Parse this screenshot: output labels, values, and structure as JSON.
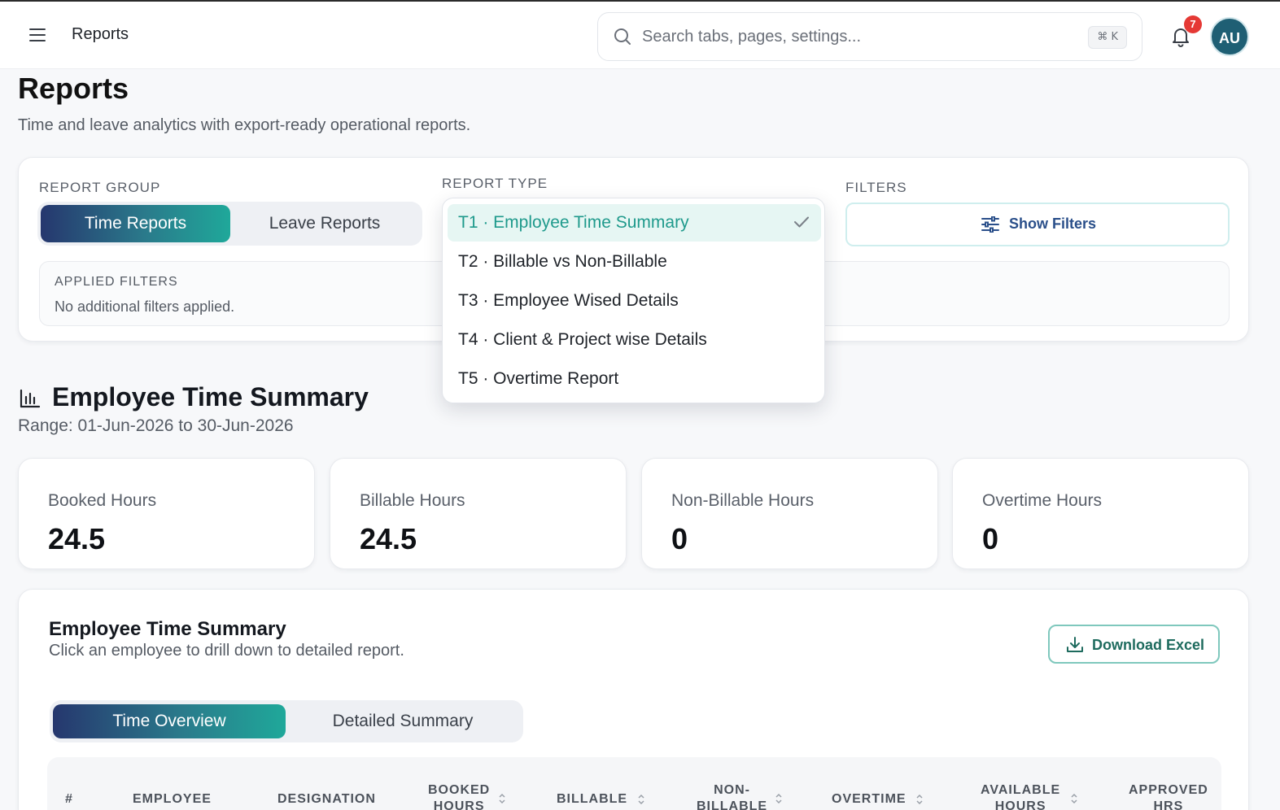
{
  "header": {
    "app_title": "Reports",
    "search_placeholder": "Search tabs, pages, settings...",
    "search_shortcut": "⌘ K",
    "notification_count": "7",
    "avatar_initials": "AU"
  },
  "page": {
    "title": "Reports",
    "subtitle": "Time and leave analytics with export-ready operational reports."
  },
  "filters_panel": {
    "report_group_label": "REPORT GROUP",
    "report_groups": [
      "Time Reports",
      "Leave Reports"
    ],
    "report_group_selected": "Time Reports",
    "report_type_label": "REPORT TYPE",
    "filters_label": "FILTERS",
    "show_filters_label": "Show Filters",
    "applied_filters_title": "APPLIED FILTERS",
    "applied_filters_value": "No additional filters applied."
  },
  "report_type_dropdown": {
    "options": [
      "T1 · Employee Time Summary",
      "T2 · Billable vs Non-Billable",
      "T3 · Employee Wised Details",
      "T4 · Client & Project wise Details",
      "T5 · Overtime Report"
    ],
    "selected": "T1 · Employee Time Summary"
  },
  "section": {
    "title": "Employee Time Summary",
    "range": "Range: 01-Jun-2026 to 30-Jun-2026"
  },
  "stats": [
    {
      "label": "Booked Hours",
      "value": "24.5"
    },
    {
      "label": "Billable Hours",
      "value": "24.5"
    },
    {
      "label": "Non-Billable Hours",
      "value": "0"
    },
    {
      "label": "Overtime Hours",
      "value": "0"
    }
  ],
  "table_card": {
    "title": "Employee Time Summary",
    "subtitle": "Click an employee to drill down to detailed report.",
    "download_label": "Download Excel",
    "view_tabs": [
      "Time Overview",
      "Detailed Summary"
    ],
    "view_selected": "Time Overview",
    "columns": [
      {
        "l1": "#",
        "l2": ""
      },
      {
        "l1": "EMPLOYEE",
        "l2": ""
      },
      {
        "l1": "DESIGNATION",
        "l2": ""
      },
      {
        "l1": "BOOKED",
        "l2": "HOURS"
      },
      {
        "l1": "BILLABLE",
        "l2": ""
      },
      {
        "l1": "NON-",
        "l2": "BILLABLE"
      },
      {
        "l1": "OVERTIME",
        "l2": ""
      },
      {
        "l1": "AVAILABLE",
        "l2": "HOURS"
      },
      {
        "l1": "APPROVED",
        "l2": "HRS"
      }
    ]
  },
  "colors": {
    "accent_gradient_start": "#26376e",
    "accent_gradient_end": "#1fa89a",
    "selected_option": "#1f9a8c",
    "badge": "#e53935"
  }
}
